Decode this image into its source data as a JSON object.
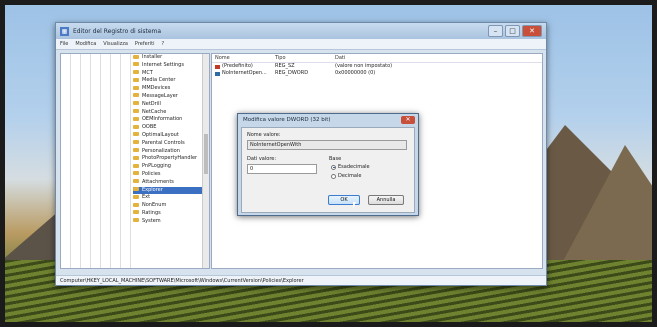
{
  "window": {
    "title": "Editor del Registro di sistema",
    "controls": [
      "–",
      "□",
      "✕"
    ],
    "menu": [
      "File",
      "Modifica",
      "Visualizza",
      "Preferiti",
      "?"
    ],
    "status_path": "Computer\\HKEY_LOCAL_MACHINE\\SOFTWARE\\Microsoft\\Windows\\CurrentVersion\\Policies\\Explorer"
  },
  "tree": {
    "items": [
      {
        "label": "Installer",
        "selected": false
      },
      {
        "label": "Internet Settings",
        "selected": false
      },
      {
        "label": "MCT",
        "selected": false
      },
      {
        "label": "Media Center",
        "selected": false
      },
      {
        "label": "MMDevices",
        "selected": false
      },
      {
        "label": "MessageLayer",
        "selected": false
      },
      {
        "label": "NetDrill",
        "selected": false
      },
      {
        "label": "NetCache",
        "selected": false
      },
      {
        "label": "OEMInformation",
        "selected": false
      },
      {
        "label": "OOBE",
        "selected": false
      },
      {
        "label": "OptimalLayout",
        "selected": false
      },
      {
        "label": "Parental Controls",
        "selected": false
      },
      {
        "label": "Personalization",
        "selected": false
      },
      {
        "label": "PhotoPropertyHandler",
        "selected": false
      },
      {
        "label": "PnPLogging",
        "selected": false
      },
      {
        "label": "Policies",
        "selected": false
      },
      {
        "label": "Attachments",
        "selected": false
      },
      {
        "label": "Explorer",
        "selected": true
      },
      {
        "label": "Ext",
        "selected": false
      },
      {
        "label": "NonEnum",
        "selected": false
      },
      {
        "label": "Ratings",
        "selected": false
      },
      {
        "label": "System",
        "selected": false
      }
    ]
  },
  "list": {
    "headers": {
      "name": "Nome",
      "type": "Tipo",
      "data": "Dati"
    },
    "rows": [
      {
        "name": "(Predefinito)",
        "type": "REG_SZ",
        "data": "(valore non impostato)",
        "icon_color": "#c0392b"
      },
      {
        "name": "NoInternetOpen...",
        "type": "REG_DWORD",
        "data": "0x00000000 (0)",
        "icon_color": "#2e6da4"
      }
    ]
  },
  "dialog": {
    "title": "Modifica valore DWORD (32 bit)",
    "close": "✕",
    "name_label": "Nome valore:",
    "name_value": "NoInternetOpenWith",
    "data_label": "Dati valore:",
    "data_value": "0",
    "base_label": "Base",
    "base_options": [
      "Esadecimale",
      "Decimale"
    ],
    "base_selected": "Esadecimale",
    "ok": "OK",
    "cancel": "Annulla"
  }
}
